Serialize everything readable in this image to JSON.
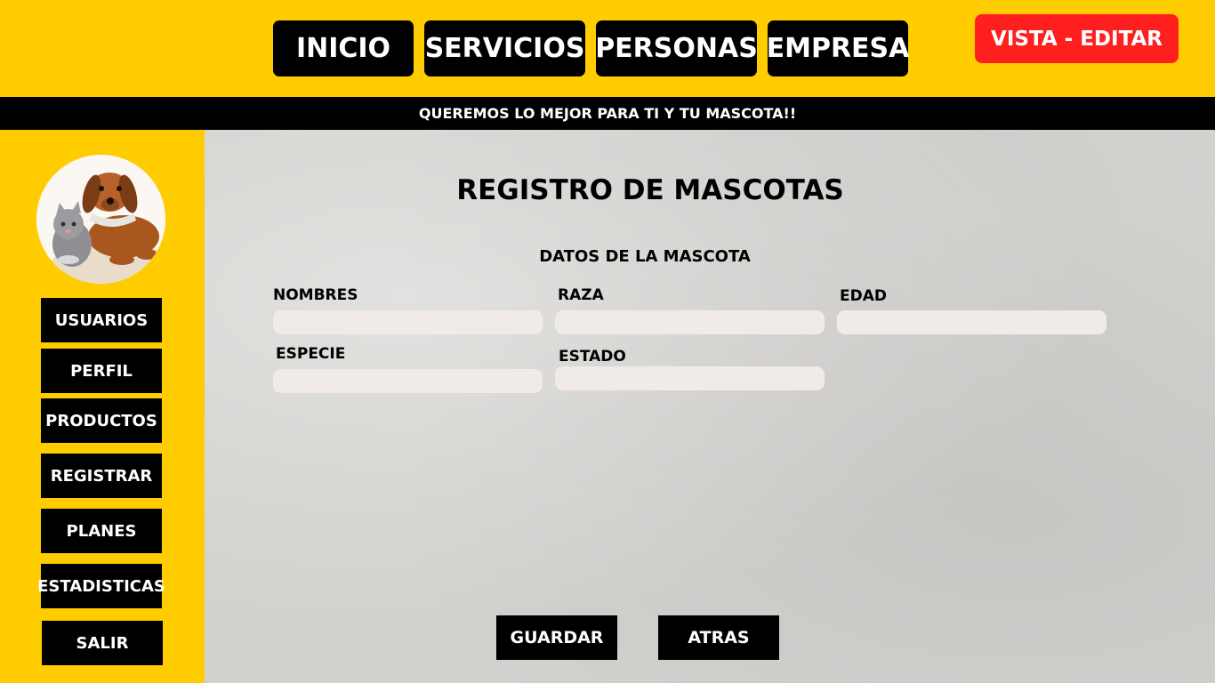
{
  "header": {
    "nav": {
      "inicio": "INICIO",
      "servicios": "SERVICIOS",
      "personas": "PERSONAS",
      "empresa": "EMPRESA"
    },
    "vista_editar": "VISTA - EDITAR"
  },
  "banner": {
    "text": "QUEREMOS LO MEJOR PARA TI Y TU MASCOTA!!"
  },
  "sidebar": {
    "items": [
      "USUARIOS",
      "PERFIL",
      "PRODUCTOS",
      "REGISTRAR",
      "PLANES",
      "ESTADISTICAS",
      "SALIR"
    ]
  },
  "main": {
    "title": "REGISTRO DE MASCOTAS",
    "subtitle": "DATOS DE LA MASCOTA",
    "fields": {
      "nombres": {
        "label": "NOMBRES",
        "value": ""
      },
      "raza": {
        "label": "RAZA",
        "value": ""
      },
      "edad": {
        "label": "EDAD",
        "value": ""
      },
      "especie": {
        "label": "ESPECIE",
        "value": ""
      },
      "estado": {
        "label": "ESTADO",
        "value": ""
      }
    },
    "actions": {
      "guardar": "GUARDAR",
      "atras": "ATRAS"
    }
  },
  "colors": {
    "brand_yellow": "#ffcc00",
    "black": "#000000",
    "accent_red": "#ff1f1f",
    "field_bg": "#f0ebe7"
  },
  "icons": {
    "avatar": "pet-dog-cat-avatar"
  }
}
